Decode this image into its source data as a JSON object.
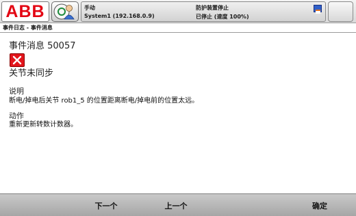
{
  "banner": {
    "logo_text": "ABB",
    "status": {
      "mode": "手动",
      "system": "System1 (192.168.0.9)",
      "guard": "防护装置停止",
      "state": "已停止 (速度 100%)"
    },
    "icons": {
      "quickset": "operator-user-icon",
      "taskbar": "program-window-icon"
    }
  },
  "window": {
    "title": "事件日志 - 事件消息"
  },
  "event": {
    "header": "事件消息 50057",
    "severity_icon": "error-x-icon",
    "title": "关节未同步",
    "description_label": "说明",
    "description": "断电/掉电后关节 rob1_5 的位置距离断电/掉电前的位置太远。",
    "action_label": "动作",
    "action": "重新更新转数计数器。"
  },
  "commands": {
    "next": "下一个",
    "previous": "上一个",
    "ok": "确定"
  },
  "colors": {
    "abb_red": "#e30613",
    "error_red": "#e2151c",
    "command_bar": "#b8b8b8"
  }
}
